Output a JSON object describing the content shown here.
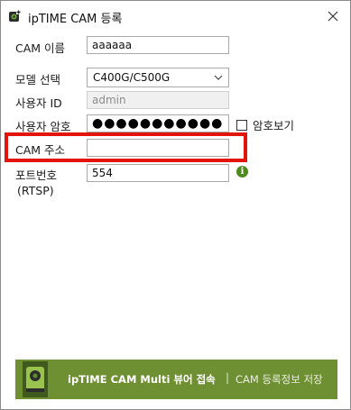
{
  "window": {
    "title": "ipTIME CAM 등록",
    "close_icon": "close-icon",
    "app_icon": "camera-app-icon"
  },
  "form": {
    "cam_name": {
      "label": "CAM 이름",
      "value": "aaaaaa"
    },
    "model": {
      "label": "모델 선택",
      "selected": "C400G/C500G"
    },
    "username": {
      "label": "사용자 ID",
      "value": "admin"
    },
    "password": {
      "label": "사용자 암호",
      "masked": "●●●●●●●●●●●",
      "show_label": "암호보기"
    },
    "cam_address": {
      "label": "CAM 주소",
      "value": ""
    },
    "port": {
      "label_line1": "포트번호",
      "label_line2": "(RTSP)",
      "value": "554"
    }
  },
  "footer": {
    "main_link": "ipTIME CAM Multi 뷰어 접속",
    "separator": "|",
    "sub_link": "CAM 등록정보 저장"
  },
  "colors": {
    "highlight": "#e3140c",
    "footer_bg": "#6f8f33",
    "info_icon": "#4e8a1f"
  }
}
